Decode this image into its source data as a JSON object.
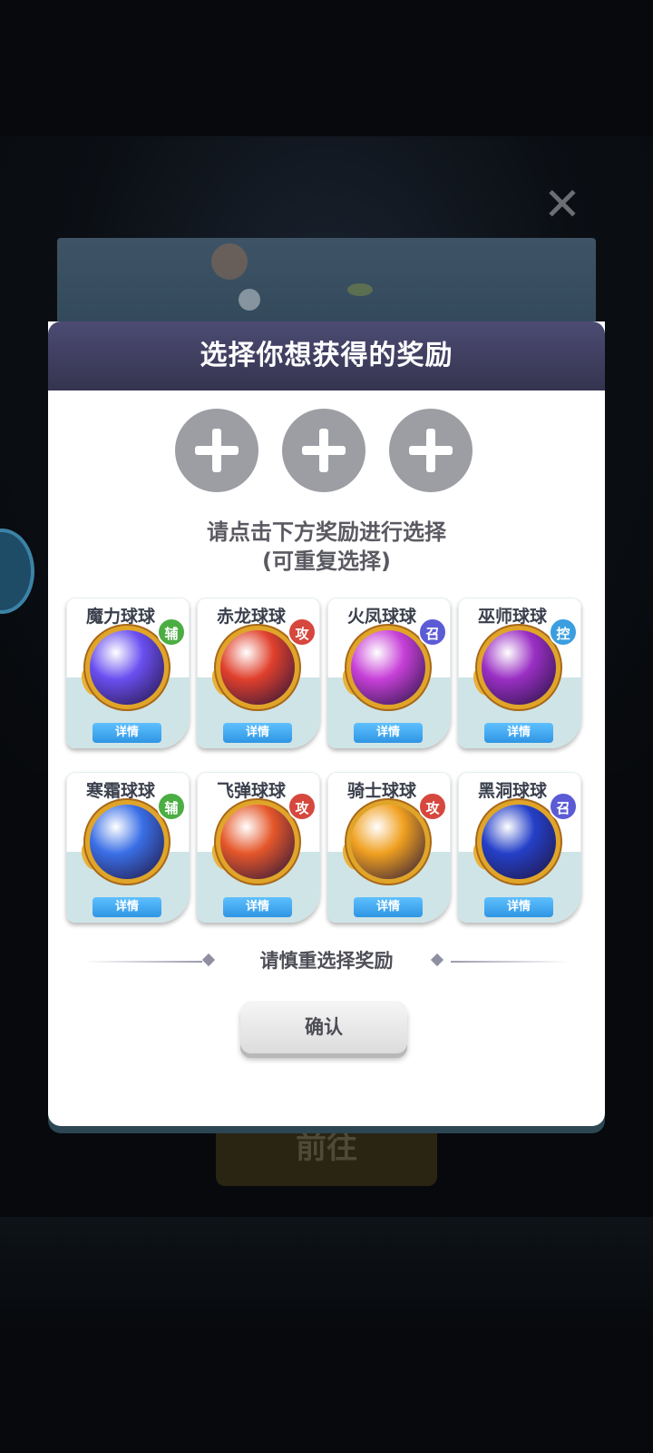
{
  "background": {
    "close_symbol": "✕",
    "goto_label": "前往"
  },
  "dialog": {
    "title": "选择你想获得的奖励",
    "slots": [
      "plus-icon",
      "plus-icon",
      "plus-icon"
    ],
    "instruction_line1": "请点击下方奖励进行选择",
    "instruction_line2": "(可重复选择)",
    "caution": "请慎重选择奖励",
    "confirm_label": "确认"
  },
  "rewards": [
    {
      "name": "魔力球球",
      "tag": "辅",
      "tag_color": "#4bae42",
      "ball_color": "#6a4ff0",
      "detail": "详情"
    },
    {
      "name": "赤龙球球",
      "tag": "攻",
      "tag_color": "#d6473d",
      "ball_color": "#e0402c",
      "detail": "详情"
    },
    {
      "name": "火凤球球",
      "tag": "召",
      "tag_color": "#5b5bd6",
      "ball_color": "#c740d8",
      "detail": "详情"
    },
    {
      "name": "巫师球球",
      "tag": "控",
      "tag_color": "#3a9ee0",
      "ball_color": "#9a2fc4",
      "detail": "详情"
    },
    {
      "name": "寒霜球球",
      "tag": "辅",
      "tag_color": "#4bae42",
      "ball_color": "#3a6fe6",
      "detail": "详情"
    },
    {
      "name": "飞弹球球",
      "tag": "攻",
      "tag_color": "#d6473d",
      "ball_color": "#e5572a",
      "detail": "详情"
    },
    {
      "name": "骑士球球",
      "tag": "攻",
      "tag_color": "#d6473d",
      "ball_color": "#f0a020",
      "detail": "详情"
    },
    {
      "name": "黑洞球球",
      "tag": "召",
      "tag_color": "#5b5bd6",
      "ball_color": "#2440c8",
      "detail": "详情"
    }
  ]
}
